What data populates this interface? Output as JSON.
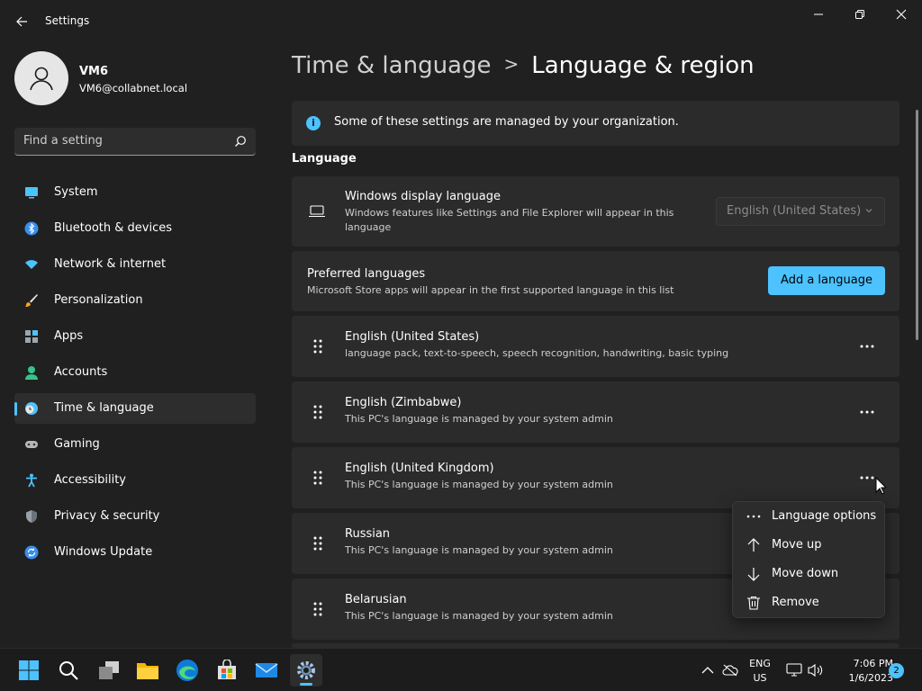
{
  "window": {
    "title": "Settings"
  },
  "user": {
    "name": "VM6",
    "email": "VM6@collabnet.local"
  },
  "search": {
    "placeholder": "Find a setting"
  },
  "sidebar": {
    "items": [
      {
        "label": "System",
        "icon": "monitor-icon"
      },
      {
        "label": "Bluetooth & devices",
        "icon": "bluetooth-icon"
      },
      {
        "label": "Network & internet",
        "icon": "wifi-icon"
      },
      {
        "label": "Personalization",
        "icon": "brush-icon"
      },
      {
        "label": "Apps",
        "icon": "apps-icon"
      },
      {
        "label": "Accounts",
        "icon": "person-icon"
      },
      {
        "label": "Time & language",
        "icon": "clock-globe-icon",
        "active": true
      },
      {
        "label": "Gaming",
        "icon": "gamepad-icon"
      },
      {
        "label": "Accessibility",
        "icon": "accessibility-icon"
      },
      {
        "label": "Privacy & security",
        "icon": "shield-icon"
      },
      {
        "label": "Windows Update",
        "icon": "update-icon"
      }
    ]
  },
  "breadcrumb": {
    "parent": "Time & language",
    "separator": ">",
    "current": "Language & region"
  },
  "info": {
    "text": "Some of these settings are managed by your organization."
  },
  "section": {
    "language": "Language"
  },
  "display_language": {
    "title": "Windows display language",
    "description": "Windows features like Settings and File Explorer will appear in this language",
    "value": "English (United States)"
  },
  "preferred": {
    "title": "Preferred languages",
    "description": "Microsoft Store apps will appear in the first supported language in this list",
    "add_button": "Add a language"
  },
  "languages": [
    {
      "name": "English (United States)",
      "detail": "language pack, text-to-speech, speech recognition, handwriting, basic typing"
    },
    {
      "name": "English (Zimbabwe)",
      "detail": "This PC's language is managed by your system admin"
    },
    {
      "name": "English (United Kingdom)",
      "detail": "This PC's language is managed by your system admin"
    },
    {
      "name": "Russian",
      "detail": "This PC's language is managed by your system admin"
    },
    {
      "name": "Belarusian",
      "detail": "This PC's language is managed by your system admin"
    }
  ],
  "context_menu": {
    "items": [
      {
        "label": "Language options",
        "icon": "more-horizontal-icon"
      },
      {
        "label": "Move up",
        "icon": "arrow-up-icon"
      },
      {
        "label": "Move down",
        "icon": "arrow-down-icon"
      },
      {
        "label": "Remove",
        "icon": "trash-icon"
      }
    ]
  },
  "taskbar": {
    "tray_lang_line1": "ENG",
    "tray_lang_line2": "US",
    "time": "7:06 PM",
    "date": "1/6/2023",
    "notification_count": "2"
  },
  "colors": {
    "accent": "#4cc2ff",
    "background": "#202020",
    "card": "#2b2b2b"
  }
}
